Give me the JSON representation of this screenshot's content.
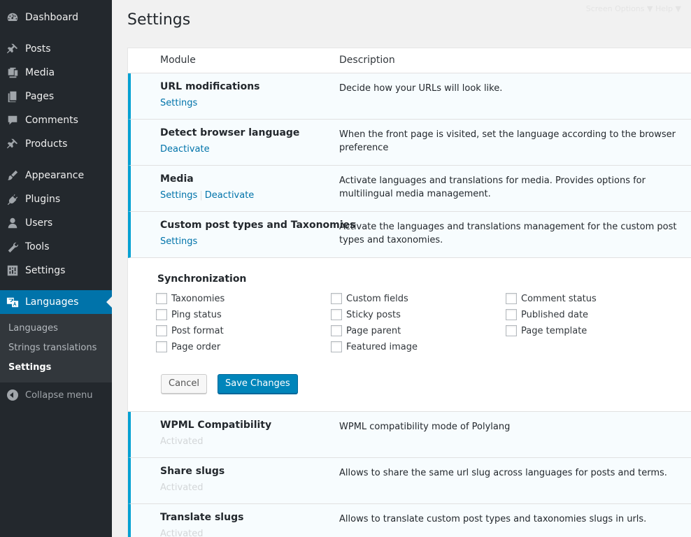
{
  "sidebar": {
    "items": [
      {
        "label": "Dashboard",
        "icon": "dashboard-icon"
      },
      {
        "label": "Posts",
        "icon": "pin-icon"
      },
      {
        "label": "Media",
        "icon": "media-icon"
      },
      {
        "label": "Pages",
        "icon": "pages-icon"
      },
      {
        "label": "Comments",
        "icon": "comment-icon"
      },
      {
        "label": "Products",
        "icon": "pin-icon"
      },
      {
        "label": "Appearance",
        "icon": "brush-icon"
      },
      {
        "label": "Plugins",
        "icon": "plug-icon"
      },
      {
        "label": "Users",
        "icon": "user-icon"
      },
      {
        "label": "Tools",
        "icon": "wrench-icon"
      },
      {
        "label": "Settings",
        "icon": "sliders-icon"
      },
      {
        "label": "Languages",
        "icon": "translation-icon"
      }
    ],
    "submenu": [
      "Languages",
      "Strings translations",
      "Settings"
    ],
    "collapse_label": "Collapse menu"
  },
  "header": {
    "title": "Settings",
    "screen_meta": "Screen Options  ▼    Help  ▼"
  },
  "table": {
    "col_module": "Module",
    "col_description": "Description",
    "rows": [
      {
        "title": "URL modifications",
        "actions": [
          "Settings"
        ],
        "description": "Decide how your URLs will look like."
      },
      {
        "title": "Detect browser language",
        "actions": [
          "Deactivate"
        ],
        "description": "When the front page is visited, set the language according to the browser preference"
      },
      {
        "title": "Media",
        "actions": [
          "Settings",
          "Deactivate"
        ],
        "separator": "|",
        "description": "Activate languages and translations for media. Provides options for multilingual media management."
      },
      {
        "title": "Custom post types and Taxonomies",
        "actions": [
          "Settings"
        ],
        "description": "Activate the languages and translations management for the custom post types and taxonomies."
      },
      {
        "title": "WPML Compatibility",
        "status": "Activated",
        "description": "WPML compatibility mode of Polylang"
      },
      {
        "title": "Share slugs",
        "status": "Activated",
        "description": "Allows to share the same url slug across languages for posts and terms."
      },
      {
        "title": "Translate slugs",
        "status": "Activated",
        "description": "Allows to translate custom post types and taxonomies slugs in urls."
      }
    ]
  },
  "sync": {
    "title": "Synchronization",
    "options": [
      "Taxonomies",
      "Ping status",
      "Post format",
      "Page order",
      "Custom fields",
      "Sticky posts",
      "Page parent",
      "Featured image",
      "Comment status",
      "Published date",
      "Page template"
    ],
    "cancel_label": "Cancel",
    "save_label": "Save Changes"
  },
  "colors": {
    "sidebar_bg": "#23282d",
    "accent": "#0073aa",
    "row_border": "#00a0d2",
    "primary_button": "#0085ba"
  }
}
